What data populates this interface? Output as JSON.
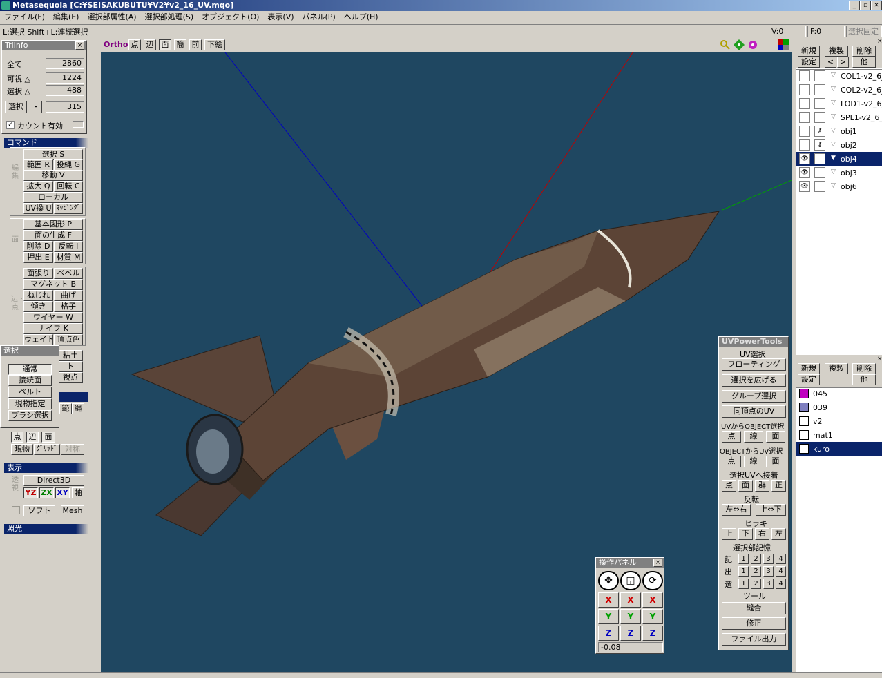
{
  "window": {
    "title": "Metasequoia [C:¥SEISAKUBUTU¥V2¥v2_16_UV.mqo]",
    "min": "_",
    "max": "▫",
    "close": "✕"
  },
  "menu": [
    "ファイル(F)",
    "編集(E)",
    "選択部属性(A)",
    "選択部処理(S)",
    "オブジェクト(O)",
    "表示(V)",
    "パネル(P)",
    "ヘルプ(H)"
  ],
  "status": {
    "hint": "L:選択 Shift+L:連続選択",
    "v": "V:0",
    "f": "F:0",
    "lock": "選択固定"
  },
  "triinfo": {
    "title": "TriInfo",
    "close": "×",
    "all_label": "全て",
    "all": "2860",
    "visible_label": "可視 △",
    "visible": "1224",
    "selected_label": "選択 △",
    "selected": "488",
    "sel_btn": "選択",
    "dot_btn": "・",
    "sel_val": "315",
    "count_label": "カウント有効"
  },
  "command": {
    "header": "コマンド",
    "edit_label": "編集",
    "edit": [
      {
        "a": "選択 S"
      },
      {
        "a": "範囲 R",
        "b": "投縄 G"
      },
      {
        "a": "移動 V"
      },
      {
        "a": "拡大 Q",
        "b": "回転 C"
      },
      {
        "a": "ローカル"
      },
      {
        "a": "UV操 U",
        "b": "ﾏｯﾋﾟﾝｸﾞ"
      }
    ],
    "face_label": "面",
    "face": [
      {
        "a": "基本図形 P"
      },
      {
        "a": "面の生成 F"
      },
      {
        "a": "削除 D",
        "b": "反転 I"
      },
      {
        "a": "押出 E",
        "b": "材質 M"
      }
    ],
    "edge_label": "辺・点",
    "edge": [
      {
        "a": "面張り",
        "b": "ベベル"
      },
      {
        "a": "マグネット B"
      },
      {
        "a": "ねじれ",
        "b": "曲げ"
      },
      {
        "a": "傾き",
        "b": "格子"
      },
      {
        "a": "ワイヤー W"
      },
      {
        "a": "ナイフ K"
      },
      {
        "a": "ウェイト",
        "b": "頂点色"
      }
    ],
    "extra": [
      "粘土",
      "ト",
      "視点"
    ]
  },
  "select_popup": {
    "title": "選択",
    "items": [
      "通常",
      "接続面",
      "ベルト",
      "現物指定",
      "ブラシ選択"
    ]
  },
  "selmode": {
    "range": "範",
    "lasso": "縄",
    "point": "点",
    "edge": "辺",
    "face": "面",
    "real": "現物",
    "grid": "ｸﾞﾘｯﾄﾞ",
    "sym": "対称"
  },
  "display": {
    "header": "表示",
    "d3d": "Direct3D",
    "yz": "YZ",
    "zx": "ZX",
    "xy": "XY",
    "axis": "軸",
    "soft": "ソフト",
    "mesh": "Mesh",
    "persp": "透視"
  },
  "light": {
    "header": "照光"
  },
  "viewtool": {
    "ortho": "Ortho",
    "items": [
      "点",
      "辺",
      "面",
      "簡",
      "前",
      "下絵"
    ]
  },
  "objpanel": {
    "new": "新規",
    "dup": "複製",
    "del": "削除",
    "set": "設定",
    "prev": "<",
    "next": ">",
    "other": "他",
    "objects": [
      {
        "name": "COL1-v2_6_",
        "eye": false,
        "lock": false,
        "sel": false
      },
      {
        "name": "COL2-v2_6_",
        "eye": false,
        "lock": false,
        "sel": false
      },
      {
        "name": "LOD1-v2_6_",
        "eye": false,
        "lock": false,
        "sel": false
      },
      {
        "name": "SPL1-v2_6_",
        "eye": false,
        "lock": false,
        "sel": false
      },
      {
        "name": "obj1",
        "eye": false,
        "lock": true,
        "sel": false
      },
      {
        "name": "obj2",
        "eye": false,
        "lock": true,
        "sel": false
      },
      {
        "name": "obj4",
        "eye": true,
        "lock": false,
        "sel": true
      },
      {
        "name": "obj3",
        "eye": true,
        "lock": false,
        "sel": false
      },
      {
        "name": "obj6",
        "eye": true,
        "lock": false,
        "sel": false
      }
    ]
  },
  "matpanel": {
    "new": "新規",
    "dup": "複製",
    "del": "削除",
    "set": "設定",
    "other": "他",
    "materials": [
      {
        "name": "045",
        "color": "#c000c0",
        "sel": false
      },
      {
        "name": "039",
        "color": "#8080c0",
        "sel": false
      },
      {
        "name": "v2",
        "color": "#ffffff",
        "sel": false
      },
      {
        "name": "mat1",
        "color": "#ffffff",
        "sel": false
      },
      {
        "name": "kuro",
        "color": "#ffffff",
        "sel": true
      }
    ]
  },
  "uvpower": {
    "title": "UVPowerTools",
    "uvsel": "UV選択",
    "floating": "フローティング",
    "expand": "選択を広げる",
    "group": "グループ選択",
    "samevert": "同頂点のUV",
    "uv2obj": "UVからOBJECT選択",
    "obj2uv": "OBJECTからUV選択",
    "pt": "点",
    "ln": "線",
    "fc": "面",
    "adhere": "選択UVへ接着",
    "grp": "群",
    "pos": "正",
    "flip": "反転",
    "lr": "左⇔右",
    "ud": "上⇔下",
    "hirake": "ヒラキ",
    "up": "上",
    "down": "下",
    "right": "右",
    "left": "左",
    "memory": "選択部記憶",
    "rec": "記",
    "out": "出",
    "sel": "選",
    "nums": [
      "1",
      "2",
      "3",
      "4"
    ],
    "tool": "ツール",
    "stitch": "縫合",
    "fix": "修正",
    "fileout": "ファイル出力"
  },
  "oppanel": {
    "title": "操作パネル",
    "x": "X",
    "y": "Y",
    "z": "Z",
    "value": "-0.08"
  },
  "colors": {
    "viewport": "#1f4761",
    "titlebar": "#0a246a",
    "x_axis": "#c00000",
    "y_axis": "#00a000",
    "z_axis": "#0000c0"
  }
}
